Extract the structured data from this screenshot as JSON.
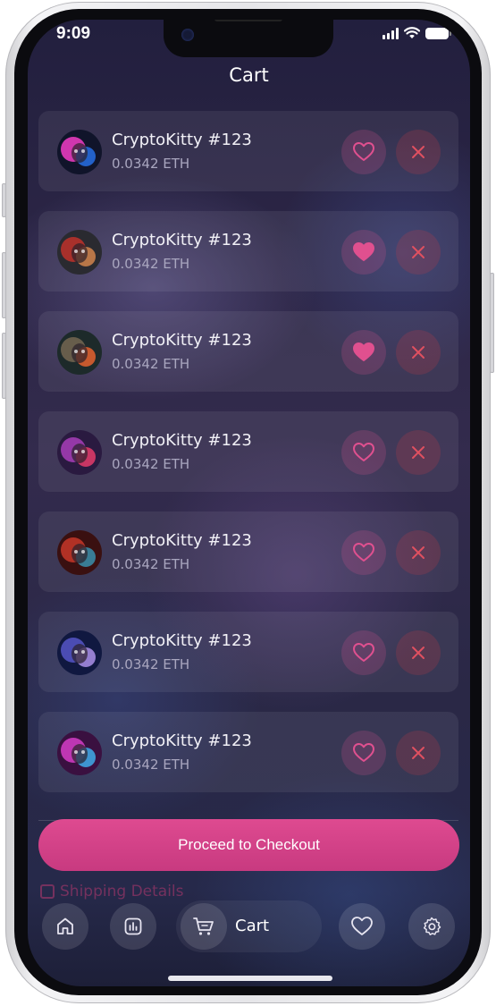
{
  "status_bar": {
    "time": "9:09"
  },
  "header": {
    "title": "Cart"
  },
  "cart": {
    "items": [
      {
        "name": "CryptoKitty #123",
        "price": "0.0342 ETH",
        "favorited": false,
        "avatar_colors": [
          "#ff3fd0",
          "#2a7bff",
          "#10142a"
        ]
      },
      {
        "name": "CryptoKitty #123",
        "price": "0.0342 ETH",
        "favorited": true,
        "avatar_colors": [
          "#c8322a",
          "#e89050",
          "#2a2a30"
        ]
      },
      {
        "name": "CryptoKitty #123",
        "price": "0.0342 ETH",
        "favorited": true,
        "avatar_colors": [
          "#7a6a54",
          "#ff6a30",
          "#1d2a2a"
        ]
      },
      {
        "name": "CryptoKitty #123",
        "price": "0.0342 ETH",
        "favorited": false,
        "avatar_colors": [
          "#b040c0",
          "#ff4070",
          "#2a1a40"
        ]
      },
      {
        "name": "CryptoKitty #123",
        "price": "0.0342 ETH",
        "favorited": false,
        "avatar_colors": [
          "#d03a2a",
          "#3aa0c0",
          "#3a1010"
        ]
      },
      {
        "name": "CryptoKitty #123",
        "price": "0.0342 ETH",
        "favorited": false,
        "avatar_colors": [
          "#5a5ad0",
          "#c0a0ff",
          "#101840"
        ]
      },
      {
        "name": "CryptoKitty #123",
        "price": "0.0342 ETH",
        "favorited": false,
        "avatar_colors": [
          "#e040d0",
          "#40c0ff",
          "#3a1040"
        ]
      }
    ]
  },
  "checkout": {
    "label": "Proceed to Checkout"
  },
  "shipping": {
    "label": "Shipping Details"
  },
  "tab_bar": {
    "tabs": [
      {
        "icon": "home-icon",
        "active": false
      },
      {
        "icon": "chart-icon",
        "active": false
      },
      {
        "icon": "cart-icon",
        "label": "Cart",
        "active": true
      },
      {
        "icon": "heart-icon",
        "active": false
      },
      {
        "icon": "gear-icon",
        "active": false
      }
    ]
  },
  "colors": {
    "accent": "#d94589",
    "heart": "#e0508f",
    "remove": "#e05060"
  }
}
